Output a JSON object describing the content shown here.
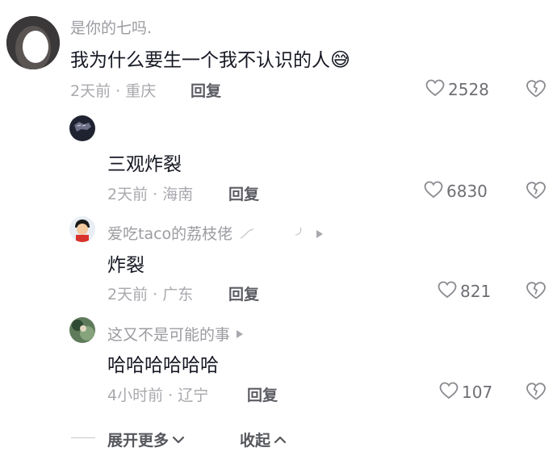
{
  "main_comment": {
    "username": "是你的七吗.",
    "text": "我为什么要生一个我不认识的人",
    "emoji": "😅",
    "time_location": "2天前 · 重庆",
    "reply_label": "回复",
    "like_count": "2528"
  },
  "replies": [
    {
      "username": "",
      "text": "三观炸裂",
      "time_location": "2天前 · 海南",
      "reply_label": "回复",
      "like_count": "6830"
    },
    {
      "username": "爱吃taco的荔枝佬",
      "text": "炸裂",
      "time_location": "2天前 · 广东",
      "reply_label": "回复",
      "like_count": "821"
    },
    {
      "username": "这又不是可能的事",
      "text": "哈哈哈哈哈哈",
      "time_location": "4小时前 · 辽宁",
      "reply_label": "回复",
      "like_count": "107"
    }
  ],
  "footer": {
    "expand_label": "展开更多",
    "collapse_label": "收起"
  },
  "icons": {
    "like": "heart-outline-icon",
    "dislike": "broken-heart-icon",
    "expand": "chevron-down-icon",
    "collapse": "chevron-up-icon",
    "play": "play-triangle-icon"
  },
  "colors": {
    "text": "#161823",
    "secondary": "#a8a8ae",
    "reply": "#5c5d63"
  }
}
